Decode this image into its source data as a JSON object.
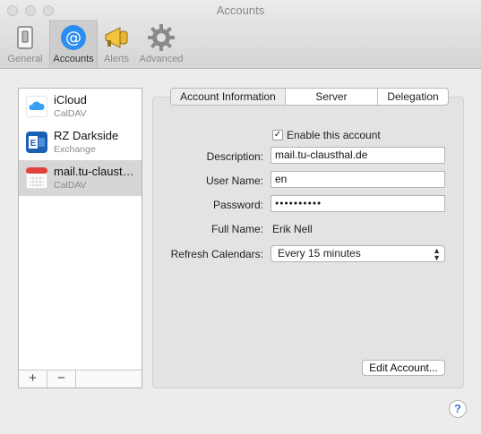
{
  "window": {
    "title": "Accounts"
  },
  "toolbar": {
    "items": [
      {
        "label": "General",
        "icon": "switch-icon"
      },
      {
        "label": "Accounts",
        "icon": "at-sign-icon"
      },
      {
        "label": "Alerts",
        "icon": "megaphone-icon"
      },
      {
        "label": "Advanced",
        "icon": "gear-icon"
      }
    ],
    "selected": "Accounts"
  },
  "accounts": [
    {
      "name": "iCloud",
      "type": "CalDAV",
      "icon": "cloud-icon",
      "color": "#2b9af3"
    },
    {
      "name": "RZ Darkside",
      "type": "Exchange",
      "icon": "exchange-icon",
      "color": "#1a5fb4"
    },
    {
      "name": "mail.tu-clausthal.de",
      "type": "CalDAV",
      "icon": "calendar-icon",
      "color": "#e0433b"
    }
  ],
  "sidebar_footer": {
    "add": "+",
    "remove": "−"
  },
  "tabs": [
    "Account Information",
    "Server Settings",
    "Delegation"
  ],
  "form": {
    "enable_label": "Enable this account",
    "enabled": true,
    "description_label": "Description:",
    "description_value": "mail.tu-clausthal.de",
    "username_label": "User Name:",
    "username_value": "en",
    "password_label": "Password:",
    "password_value": "●●●●●●●●●●",
    "fullname_label": "Full Name:",
    "fullname_value": "Erik Nell",
    "refresh_label": "Refresh Calendars:",
    "refresh_value": "Every 15 minutes",
    "edit_button": "Edit Account..."
  },
  "help": "?"
}
